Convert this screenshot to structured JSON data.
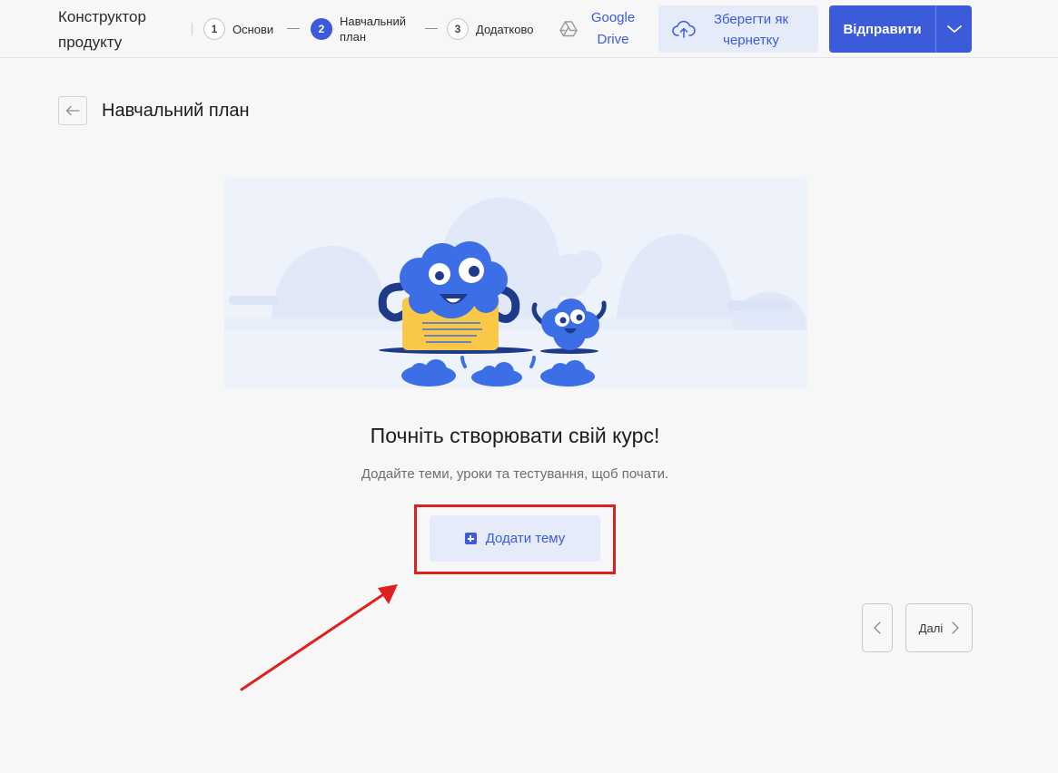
{
  "header": {
    "app_title": "Конструктор продукту",
    "steps": [
      {
        "number": "1",
        "label": "Основи",
        "active": false
      },
      {
        "number": "2",
        "label": "Навчальний план",
        "active": true
      },
      {
        "number": "3",
        "label": "Додатково",
        "active": false
      }
    ],
    "google_drive_label": "Google Drive",
    "save_draft_label": "Зберегти як чернетку",
    "send_label": "Відправити"
  },
  "page": {
    "title": "Навчальний план",
    "empty_heading": "Почніть створювати свій курс!",
    "empty_subtext": "Додайте теми, уроки та тестування, щоб почати.",
    "add_topic_label": "Додати тему"
  },
  "pagination": {
    "next_label": "Далі"
  },
  "icons": {
    "back": "arrow-left-icon",
    "google_drive": "google-drive-icon",
    "cloud_upload": "cloud-upload-icon",
    "dropdown": "chevron-down-icon",
    "add": "plus-square-icon",
    "prev": "chevron-left-icon",
    "next": "chevron-right-icon"
  },
  "colors": {
    "accent": "#3b5bdb",
    "accent_light": "#e6ebfa",
    "annotation_red": "#e0201f",
    "illustration_yellow": "#f9c846",
    "illustration_blue": "#3c6ee6"
  }
}
